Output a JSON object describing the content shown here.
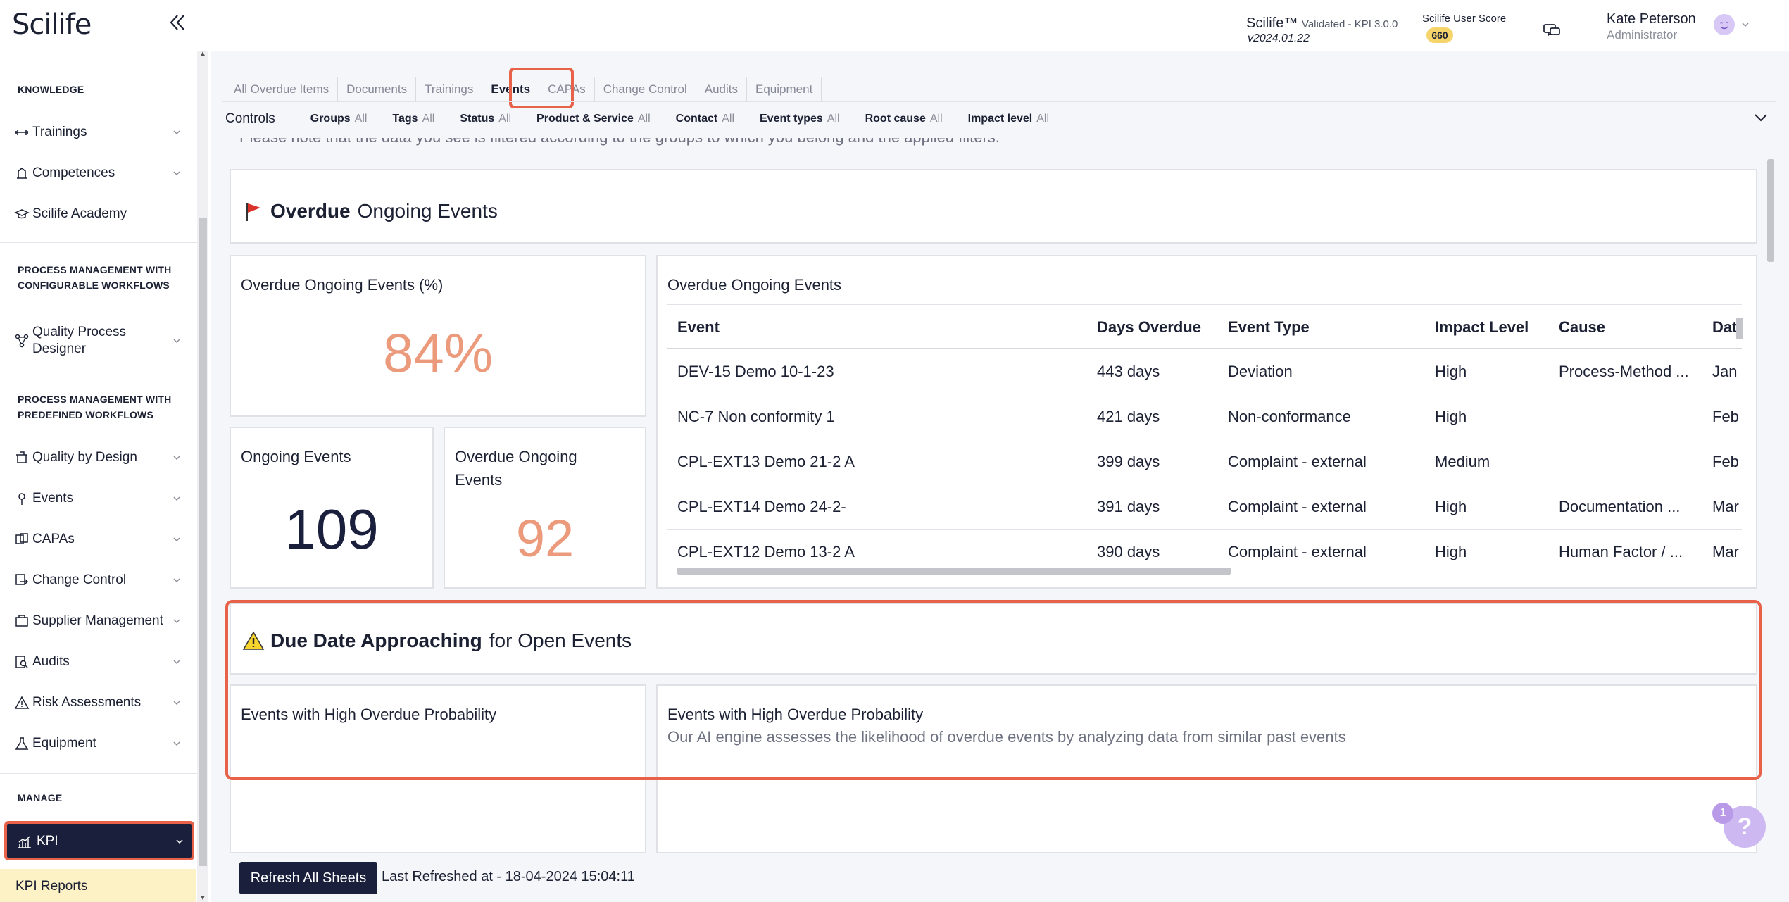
{
  "app": {
    "logo": "Scilife"
  },
  "sidebar": {
    "sections": {
      "knowledge": "KNOWLEDGE",
      "configurable_line1": "PROCESS MANAGEMENT WITH",
      "configurable_line2": "CONFIGURABLE WORKFLOWS",
      "predefined_line1": "PROCESS MANAGEMENT WITH",
      "predefined_line2": "PREDEFINED WORKFLOWS",
      "manage": "MANAGE"
    },
    "items": {
      "trainings": "Trainings",
      "competences": "Competences",
      "academy": "Scilife Academy",
      "qpd_line1": "Quality Process",
      "qpd_line2": "Designer",
      "qbd": "Quality by Design",
      "events": "Events",
      "capas": "CAPAs",
      "change_control": "Change Control",
      "supplier": "Supplier Management",
      "audits": "Audits",
      "risk": "Risk Assessments",
      "equipment": "Equipment",
      "kpi": "KPI",
      "kpi_reports": "KPI Reports"
    }
  },
  "header": {
    "version_title": "Scilife™",
    "version_validated": "Validated - KPI 3.0.0",
    "version_number": "v2024.01.22",
    "score_label": "Scilife User Score",
    "score_value": "660",
    "user_name": "Kate Peterson",
    "user_role": "Administrator"
  },
  "tabs": [
    "All Overdue Items",
    "Documents",
    "Trainings",
    "Events",
    "CAPAs",
    "Change Control",
    "Audits",
    "Equipment"
  ],
  "controls": {
    "title": "Controls",
    "filters": [
      {
        "label": "Groups",
        "value": "All"
      },
      {
        "label": "Tags",
        "value": "All"
      },
      {
        "label": "Status",
        "value": "All"
      },
      {
        "label": "Product & Service",
        "value": "All"
      },
      {
        "label": "Contact",
        "value": "All"
      },
      {
        "label": "Event types",
        "value": "All"
      },
      {
        "label": "Root cause",
        "value": "All"
      },
      {
        "label": "Impact level",
        "value": "All"
      }
    ]
  },
  "note": "Please note that the data you see is filtered according to the groups to which you belong and the applied filters.",
  "overdue_section": {
    "bold": "Overdue",
    "rest": "Ongoing Events"
  },
  "kpis": {
    "pct_title": "Overdue Ongoing Events (%)",
    "pct_value": "84%",
    "ongoing_title": "Ongoing Events",
    "ongoing_value": "109",
    "overdue_title": "Overdue Ongoing Events",
    "overdue_value": "92"
  },
  "table": {
    "title": "Overdue Ongoing Events",
    "columns": [
      "Event",
      "Days Overdue",
      "Event Type",
      "Impact Level",
      "Cause",
      "Dat"
    ],
    "rows": [
      [
        "DEV-15 Demo 10-1-23",
        "443 days",
        "Deviation",
        "High",
        "Process-Method ...",
        "Jan '"
      ],
      [
        "NC-7 Non conformity 1",
        "421 days",
        "Non-conformance",
        "High",
        "",
        "Feb"
      ],
      [
        "CPL-EXT13 Demo 21-2 A",
        "399 days",
        "Complaint - external",
        "Medium",
        "",
        "Feb"
      ],
      [
        "CPL-EXT14 Demo 24-2-",
        "391 days",
        "Complaint - external",
        "High",
        "Documentation ...",
        "Mar"
      ],
      [
        "CPL-EXT12 Demo 13-2 A",
        "390 days",
        "Complaint - external",
        "High",
        "Human Factor / ...",
        "Mar"
      ]
    ]
  },
  "due_section": {
    "bold": "Due Date Approaching",
    "rest": "for Open Events"
  },
  "probability": {
    "left_title": "Events with High Overdue Probability",
    "right_title": "Events with High Overdue Probability",
    "right_sub": "Our AI engine assesses the likelihood of overdue events by analyzing data from similar past events"
  },
  "footer": {
    "refresh_label": "Refresh All Sheets",
    "last_refreshed": "Last Refreshed at - 18-04-2024 15:04:11"
  },
  "help": {
    "badge": "1",
    "label": "?"
  },
  "colors": {
    "accent_highlight": "#e8624a",
    "navy": "#1a1f3c",
    "kpi_orange": "#eb9a7c"
  }
}
